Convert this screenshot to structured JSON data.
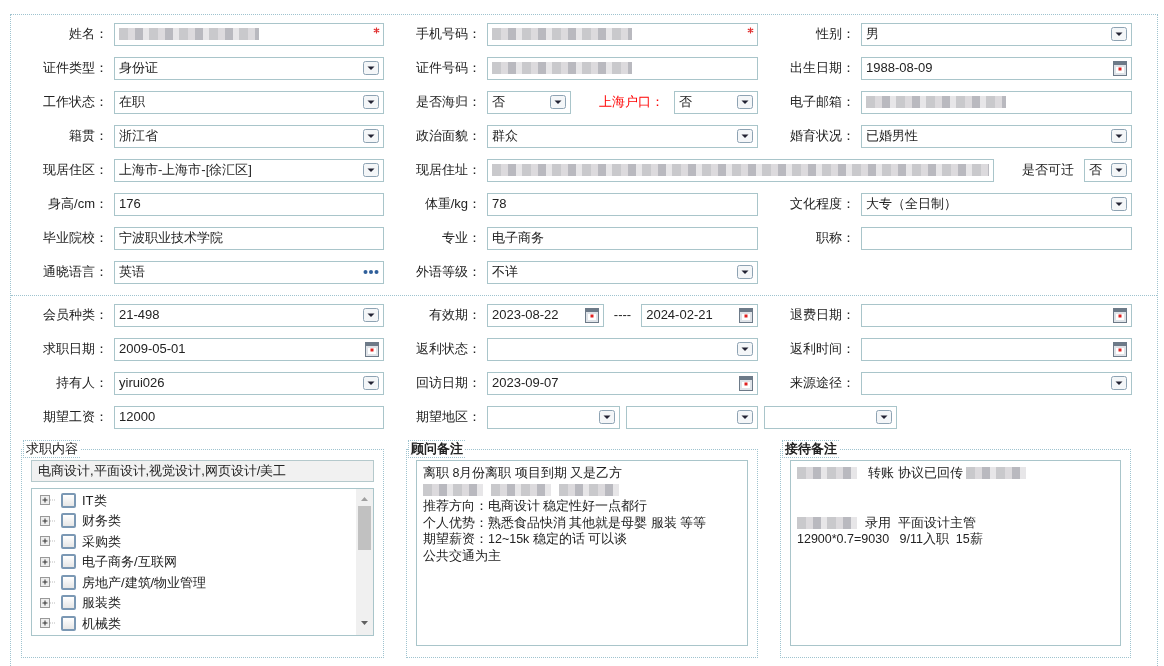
{
  "sections": [
    {
      "rows": [
        [
          {
            "label": "姓名：",
            "controls": [
              {
                "kind": "blurred",
                "required": true
              }
            ]
          },
          {
            "label": "手机号码：",
            "controls": [
              {
                "kind": "blurred",
                "required": true
              }
            ]
          },
          {
            "label": "性别：",
            "controls": [
              {
                "kind": "select",
                "value": "男"
              }
            ]
          }
        ],
        [
          {
            "label": "证件类型：",
            "controls": [
              {
                "kind": "select",
                "value": "身份证"
              }
            ]
          },
          {
            "label": "证件号码：",
            "controls": [
              {
                "kind": "blurred"
              }
            ]
          },
          {
            "label": "出生日期：",
            "controls": [
              {
                "kind": "date",
                "value": "1988-08-09"
              }
            ]
          }
        ],
        [
          {
            "label": "工作状态：",
            "controls": [
              {
                "kind": "select",
                "value": "在职"
              }
            ]
          },
          {
            "label": "是否海归：",
            "controls": [
              {
                "kind": "select",
                "value": "否"
              },
              {
                "kind": "label",
                "text": "上海户口：",
                "emphasis": true
              },
              {
                "kind": "select",
                "value": "否"
              }
            ]
          },
          {
            "label": "电子邮箱：",
            "controls": [
              {
                "kind": "blurred"
              }
            ]
          }
        ],
        [
          {
            "label": "籍贯：",
            "controls": [
              {
                "kind": "select",
                "value": "浙江省"
              }
            ]
          },
          {
            "label": "政治面貌：",
            "controls": [
              {
                "kind": "select",
                "value": "群众"
              }
            ]
          },
          {
            "label": "婚育状况：",
            "controls": [
              {
                "kind": "select",
                "value": "已婚男性"
              }
            ]
          }
        ],
        [
          {
            "label": "现居住区：",
            "controls": [
              {
                "kind": "select",
                "value": " 上海市-上海市-[徐汇区]"
              }
            ]
          },
          {
            "label": "现居住址：",
            "controls": [
              {
                "kind": "blurred"
              },
              {
                "kind": "label",
                "text": "是否可迁",
                "emphasis": false
              },
              {
                "kind": "select",
                "value": "否"
              }
            ]
          }
        ],
        [
          {
            "label": "身高/cm：",
            "controls": [
              {
                "kind": "text",
                "value": "176"
              }
            ]
          },
          {
            "label": "体重/kg：",
            "controls": [
              {
                "kind": "text",
                "value": "78"
              }
            ]
          },
          {
            "label": "文化程度：",
            "controls": [
              {
                "kind": "select",
                "value": "大专（全日制）"
              }
            ]
          }
        ],
        [
          {
            "label": "毕业院校：",
            "controls": [
              {
                "kind": "text",
                "value": "宁波职业技术学院"
              }
            ]
          },
          {
            "label": "专业：",
            "controls": [
              {
                "kind": "text",
                "value": "电子商务"
              }
            ]
          },
          {
            "label": "职称：",
            "controls": [
              {
                "kind": "text"
              }
            ]
          }
        ],
        [
          {
            "label": "通晓语言：",
            "controls": [
              {
                "kind": "lookup",
                "value": "英语"
              }
            ]
          },
          {
            "label": "外语等级：",
            "controls": [
              {
                "kind": "select",
                "value": "不详"
              }
            ]
          }
        ]
      ]
    },
    {
      "rows": [
        [
          {
            "label": "会员种类：",
            "controls": [
              {
                "kind": "select",
                "value": " 21-498"
              }
            ]
          },
          {
            "label": "有效期：",
            "controls": [
              {
                "kind": "date",
                "value": "2023-08-22"
              },
              {
                "kind": "sep",
                "text": "----"
              },
              {
                "kind": "date",
                "value": "2024-02-21"
              }
            ]
          },
          {
            "label": "退费日期：",
            "controls": [
              {
                "kind": "date"
              }
            ]
          }
        ],
        [
          {
            "label": "求职日期：",
            "controls": [
              {
                "kind": "date",
                "value": "2009-05-01"
              }
            ]
          },
          {
            "label": "返利状态：",
            "controls": [
              {
                "kind": "select"
              }
            ]
          },
          {
            "label": "返利时间：",
            "controls": [
              {
                "kind": "date"
              }
            ]
          }
        ],
        [
          {
            "label": "持有人：",
            "controls": [
              {
                "kind": "select",
                "value": "yirui026"
              }
            ]
          },
          {
            "label": "回访日期：",
            "controls": [
              {
                "kind": "date",
                "value": "2023-09-07"
              }
            ]
          },
          {
            "label": "来源途径：",
            "controls": [
              {
                "kind": "select"
              }
            ]
          }
        ],
        [
          {
            "label": "期望工资：",
            "controls": [
              {
                "kind": "text",
                "value": "12000"
              }
            ]
          },
          {
            "label": "期望地区：",
            "controls": [
              {
                "kind": "select"
              },
              {
                "kind": "select"
              },
              {
                "kind": "select"
              }
            ]
          }
        ]
      ]
    }
  ],
  "job_panel": {
    "title": "求职内容",
    "summary": "电商设计,平面设计,视觉设计,网页设计/美工",
    "tree": [
      {
        "label": "IT类",
        "expanded": false,
        "checked": false
      },
      {
        "label": "财务类",
        "expanded": false,
        "checked": false
      },
      {
        "label": "采购类",
        "expanded": false,
        "checked": false
      },
      {
        "label": "电子商务/互联网",
        "expanded": false,
        "checked": false
      },
      {
        "label": "房地产/建筑/物业管理",
        "expanded": false,
        "checked": false
      },
      {
        "label": "服装类",
        "expanded": false,
        "checked": false
      },
      {
        "label": "机械类",
        "expanded": false,
        "checked": false
      }
    ]
  },
  "note_panels": [
    {
      "title": "顾问备注",
      "lines": [
        {
          "kind": "text",
          "parts": [
            {
              "kind": "text",
              "text": "离职 8月份离职 项目到期 又是乙方"
            }
          ]
        },
        {
          "kind": "text",
          "parts": [
            {
              "kind": "blur"
            },
            {
              "kind": "blur"
            },
            {
              "kind": "blur"
            }
          ]
        },
        {
          "kind": "text",
          "parts": [
            {
              "kind": "text",
              "text": "推荐方向：电商设计 稳定性好一点都行"
            }
          ]
        },
        {
          "kind": "text",
          "parts": [
            {
              "kind": "text",
              "text": "个人优势：熟悉食品快消 其他就是母婴 服装 等等"
            }
          ]
        },
        {
          "kind": "text",
          "parts": [
            {
              "kind": "text",
              "text": "期望薪资：12~15k 稳定的话 可以谈"
            }
          ]
        },
        {
          "kind": "text",
          "parts": [
            {
              "kind": "text",
              "text": "公共交通为主"
            }
          ]
        }
      ]
    },
    {
      "title": "接待备注",
      "lines": [
        {
          "kind": "text",
          "parts": [
            {
              "kind": "blur"
            },
            {
              "kind": "text",
              "text": " 转账 协议已回传 "
            },
            {
              "kind": "blur"
            }
          ]
        },
        {
          "kind": "blank"
        },
        {
          "kind": "blank"
        },
        {
          "kind": "text",
          "parts": [
            {
              "kind": "blur"
            },
            {
              "kind": "text",
              "text": "录用  平面设计主管"
            }
          ]
        },
        {
          "kind": "text",
          "parts": [
            {
              "kind": "text",
              "text": "12900*0.7=9030   9/11入职  15薪"
            }
          ]
        }
      ]
    }
  ]
}
